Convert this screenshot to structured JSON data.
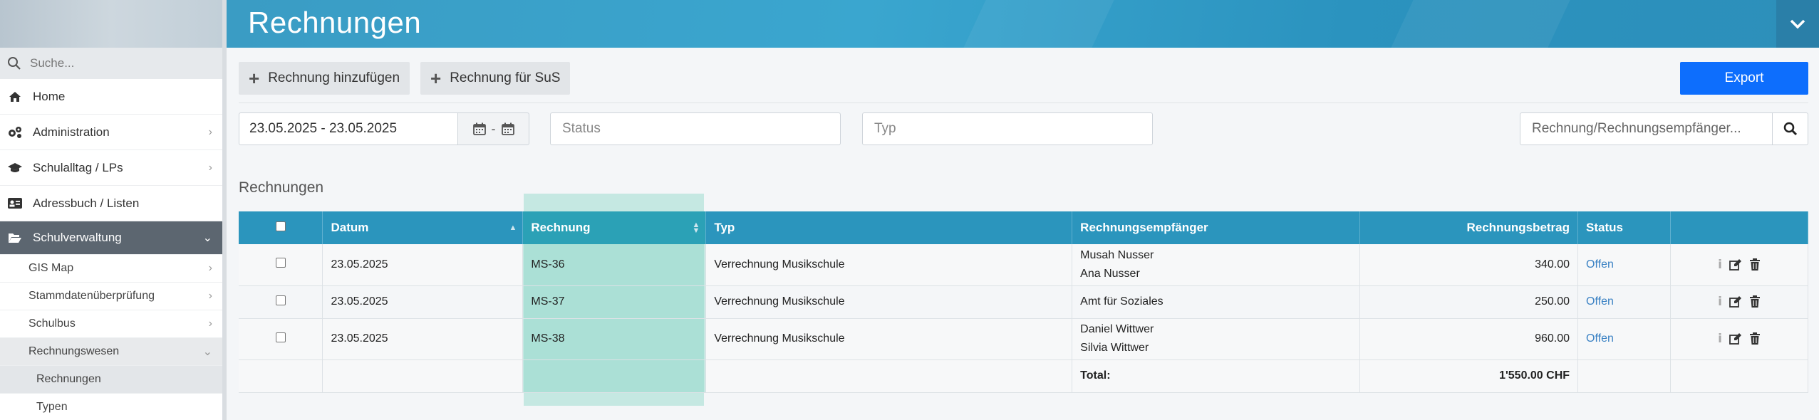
{
  "header": {
    "title": "Rechnungen"
  },
  "sidebar": {
    "search_placeholder": "Suche...",
    "items": [
      {
        "label": "Home",
        "icon": "home-icon"
      },
      {
        "label": "Administration",
        "icon": "gears-icon"
      },
      {
        "label": "Schulalltag / LPs",
        "icon": "graduation-cap-icon"
      },
      {
        "label": "Adressbuch / Listen",
        "icon": "address-card-icon"
      },
      {
        "label": "Schulverwaltung",
        "icon": "folder-open-icon"
      }
    ],
    "subitems": [
      {
        "label": "GIS Map"
      },
      {
        "label": "Stammdatenüberprüfung"
      },
      {
        "label": "Schulbus"
      },
      {
        "label": "Rechnungswesen"
      }
    ],
    "subsubitems": [
      {
        "label": "Rechnungen"
      },
      {
        "label": "Typen"
      }
    ]
  },
  "toolbar": {
    "add_invoice": "Rechnung hinzufügen",
    "add_invoice_sus": "Rechnung für SuS",
    "export": "Export"
  },
  "filters": {
    "date_range": "23.05.2025 - 23.05.2025",
    "date_sep": "-",
    "status_placeholder": "Status",
    "typ_placeholder": "Typ",
    "search_placeholder": "Rechnung/Rechnungsempfänger..."
  },
  "section_title": "Rechnungen",
  "table": {
    "columns": [
      "Datum",
      "Rechnung",
      "Typ",
      "Rechnungsempfänger",
      "Rechnungsbetrag",
      "Status"
    ],
    "rows": [
      {
        "datum": "23.05.2025",
        "rechnung": "MS-36",
        "typ": "Verrechnung Musikschule",
        "empfaenger1": "Musah Nusser",
        "empfaenger2": "Ana Nusser",
        "betrag": "340.00",
        "status": "Offen"
      },
      {
        "datum": "23.05.2025",
        "rechnung": "MS-37",
        "typ": "Verrechnung Musikschule",
        "empfaenger1": "Amt für Soziales",
        "empfaenger2": "",
        "betrag": "250.00",
        "status": "Offen"
      },
      {
        "datum": "23.05.2025",
        "rechnung": "MS-38",
        "typ": "Verrechnung Musikschule",
        "empfaenger1": "Daniel Wittwer",
        "empfaenger2": "Silvia Wittwer",
        "betrag": "960.00",
        "status": "Offen"
      }
    ],
    "total_label": "Total:",
    "total_value": "1'550.00 CHF"
  },
  "colors": {
    "header": "#3aa6cf",
    "table_header": "#2b95bd",
    "export_button": "#0d6efd",
    "status_link": "#3b82c4",
    "sidebar_active": "#5c6670"
  }
}
